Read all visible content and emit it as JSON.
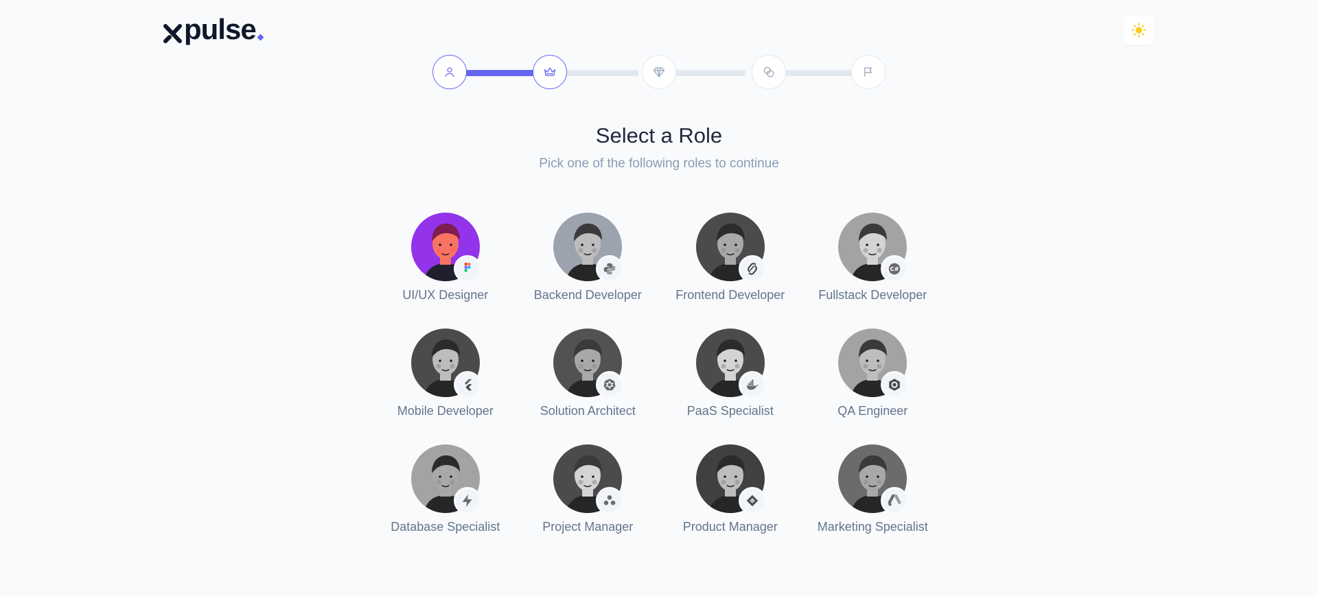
{
  "brand": {
    "name": "pulse",
    "accent": "#6366f1"
  },
  "theme_toggle": {
    "icon": "sun-icon",
    "color": "#facc15"
  },
  "stepper": {
    "steps": [
      {
        "icon": "user-icon",
        "state": "done"
      },
      {
        "icon": "crown-icon",
        "state": "current"
      },
      {
        "icon": "diamond-icon",
        "state": "upcoming"
      },
      {
        "icon": "coins-icon",
        "state": "upcoming"
      },
      {
        "icon": "flag-icon",
        "state": "upcoming"
      }
    ]
  },
  "heading": {
    "title": "Select a Role",
    "subtitle": "Pick one of the following roles to continue"
  },
  "roles": [
    {
      "label": "UI/UX Designer",
      "badge": "figma-icon",
      "avatar_bg": "#9333ea",
      "colored": true
    },
    {
      "label": "Backend Developer",
      "badge": "python-icon",
      "avatar_bg": "#9ca3af"
    },
    {
      "label": "Frontend Developer",
      "badge": "svelte-icon",
      "avatar_bg": "#4b4b4b"
    },
    {
      "label": "Fullstack Developer",
      "badge": "csharp-icon",
      "avatar_bg": "#a3a3a3"
    },
    {
      "label": "Mobile Developer",
      "badge": "flutter-icon",
      "avatar_bg": "#4b4b4b"
    },
    {
      "label": "Solution Architect",
      "badge": "kubernetes-icon",
      "avatar_bg": "#525252"
    },
    {
      "label": "PaaS Specialist",
      "badge": "docker-icon",
      "avatar_bg": "#4b4b4b"
    },
    {
      "label": "QA Engineer",
      "badge": "selenium-icon",
      "avatar_bg": "#a3a3a3"
    },
    {
      "label": "Database Specialist",
      "badge": "supabase-icon",
      "avatar_bg": "#a3a3a3"
    },
    {
      "label": "Project Manager",
      "badge": "asana-icon",
      "avatar_bg": "#4b4b4b"
    },
    {
      "label": "Product Manager",
      "badge": "jira-icon",
      "avatar_bg": "#404040"
    },
    {
      "label": "Marketing Specialist",
      "badge": "google-ads-icon",
      "avatar_bg": "#6b6b6b"
    }
  ]
}
